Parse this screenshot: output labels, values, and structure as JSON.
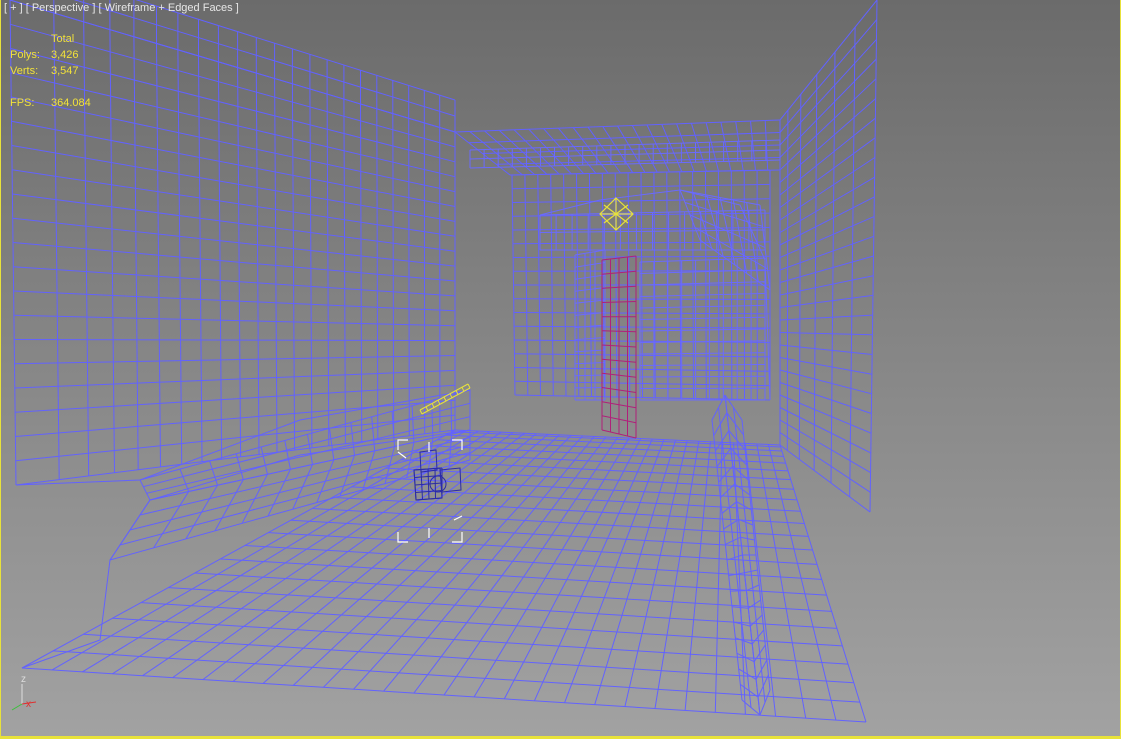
{
  "viewport": {
    "menu": {
      "plus": "[ + ]",
      "view": "[ Perspective ]",
      "shading": "[ Wireframe + Edged Faces ]"
    },
    "stats": {
      "header": "Total",
      "polys_label": "Polys:",
      "polys_value": "3,426",
      "verts_label": "Verts:",
      "verts_value": "3,547",
      "fps_label": "FPS:",
      "fps_value": "364.084"
    },
    "axis": {
      "z": "z",
      "x": "x"
    },
    "colors": {
      "wire": "#6262ff",
      "selected_mesh": "#b0207a",
      "highlight": "#e8e23a",
      "stat_text": "#f2e23a"
    }
  }
}
